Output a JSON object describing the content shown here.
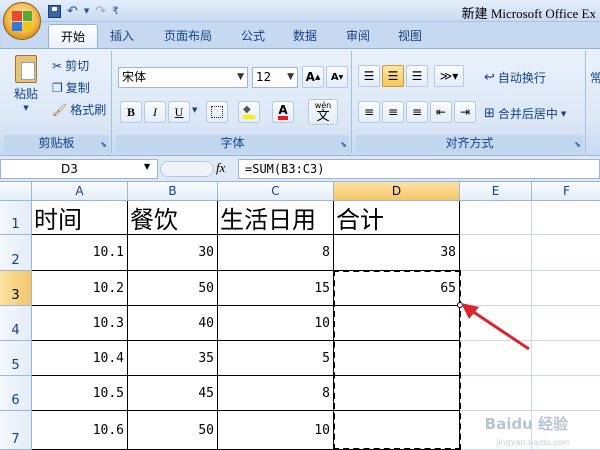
{
  "window": {
    "title": "新建 Microsoft Office Ex"
  },
  "qat": {
    "items": [
      "save-icon",
      "undo-icon",
      "redo-icon",
      "customize-icon"
    ]
  },
  "tabs": [
    {
      "label": "开始",
      "active": true
    },
    {
      "label": "插入",
      "active": false
    },
    {
      "label": "页面布局",
      "active": false
    },
    {
      "label": "公式",
      "active": false
    },
    {
      "label": "数据",
      "active": false
    },
    {
      "label": "审阅",
      "active": false
    },
    {
      "label": "视图",
      "active": false
    }
  ],
  "ribbon": {
    "clipboard": {
      "paste": "粘贴",
      "cut": "剪切",
      "copy": "复制",
      "format_painter": "格式刷",
      "label": "剪贴板"
    },
    "font": {
      "name": "宋体",
      "size": "12",
      "bold": "B",
      "italic": "I",
      "underline": "U",
      "grow": "A",
      "shrink": "A",
      "font_color_letter": "A",
      "phonetic": "wén",
      "phonetic_sub": "文",
      "label": "字体"
    },
    "alignment": {
      "wrap": "自动换行",
      "merge": "合并后居中",
      "label": "对齐方式"
    },
    "overflow_letter": "常"
  },
  "formula_bar": {
    "name_box": "D3",
    "fx": "fx",
    "formula": "=SUM(B3:C3)"
  },
  "columns": [
    "A",
    "B",
    "C",
    "D",
    "E",
    "F"
  ],
  "rows": [
    "1",
    "2",
    "3",
    "4",
    "5",
    "6",
    "7"
  ],
  "table": {
    "headers": [
      "时间",
      "餐饮",
      "生活日用",
      "合计"
    ],
    "rows": [
      [
        "10.1",
        "30",
        "8",
        "38"
      ],
      [
        "10.2",
        "50",
        "15",
        "65"
      ],
      [
        "10.3",
        "40",
        "10",
        ""
      ],
      [
        "10.4",
        "35",
        "5",
        ""
      ],
      [
        "10.5",
        "45",
        "8",
        ""
      ],
      [
        "10.6",
        "50",
        "10",
        ""
      ]
    ]
  },
  "selection": {
    "active_cell": "D3",
    "selected_column": "D",
    "selected_row": "3"
  },
  "watermark": {
    "text": "Baidu 经验",
    "sub": "jingyan.baidu.com"
  },
  "colors": {
    "ribbon_bg": "#dbe7f6",
    "selected_header": "#f5c66a",
    "arrow": "#d9262e"
  }
}
